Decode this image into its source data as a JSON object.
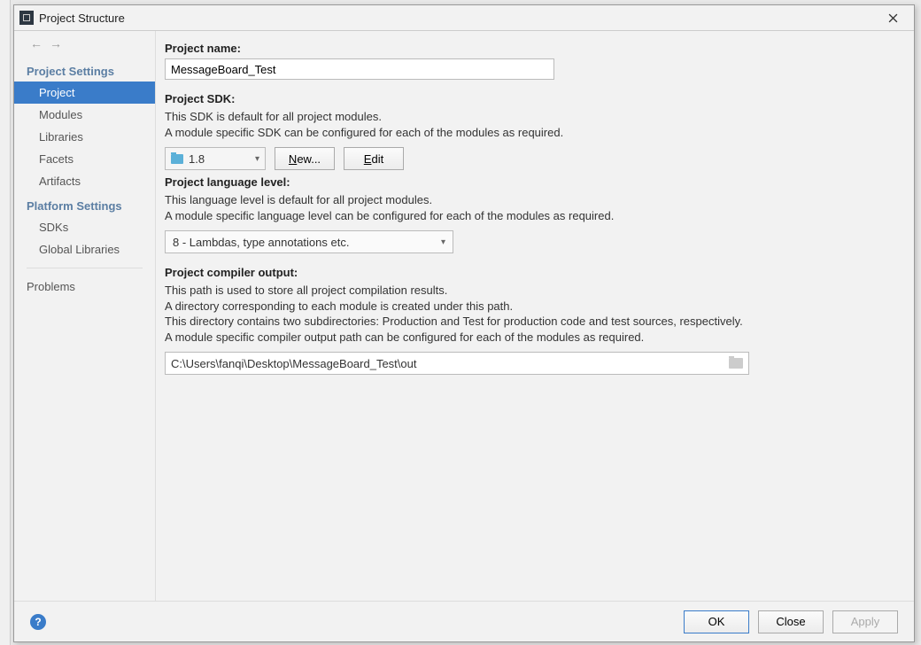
{
  "window": {
    "title": "Project Structure"
  },
  "sidebar": {
    "section1": "Project Settings",
    "items1": [
      {
        "label": "Project"
      },
      {
        "label": "Modules"
      },
      {
        "label": "Libraries"
      },
      {
        "label": "Facets"
      },
      {
        "label": "Artifacts"
      }
    ],
    "section2": "Platform Settings",
    "items2": [
      {
        "label": "SDKs"
      },
      {
        "label": "Global Libraries"
      }
    ],
    "problems": "Problems"
  },
  "project_name": {
    "label": "Project name:",
    "value": "MessageBoard_Test"
  },
  "sdk": {
    "label": "Project SDK:",
    "desc1": "This SDK is default for all project modules.",
    "desc2": "A module specific SDK can be configured for each of the modules as required.",
    "selected": "1.8",
    "new_label": "New...",
    "edit_label": "Edit"
  },
  "lang": {
    "label": "Project language level:",
    "desc1": "This language level is default for all project modules.",
    "desc2": "A module specific language level can be configured for each of the modules as required.",
    "selected": "8 - Lambdas, type annotations etc."
  },
  "out": {
    "label": "Project compiler output:",
    "desc1": "This path is used to store all project compilation results.",
    "desc2": "A directory corresponding to each module is created under this path.",
    "desc3": "This directory contains two subdirectories: Production and Test for production code and test sources, respectively.",
    "desc4": "A module specific compiler output path can be configured for each of the modules as required.",
    "value": "C:\\Users\\fanqi\\Desktop\\MessageBoard_Test\\out"
  },
  "footer": {
    "ok": "OK",
    "close": "Close",
    "apply": "Apply"
  }
}
